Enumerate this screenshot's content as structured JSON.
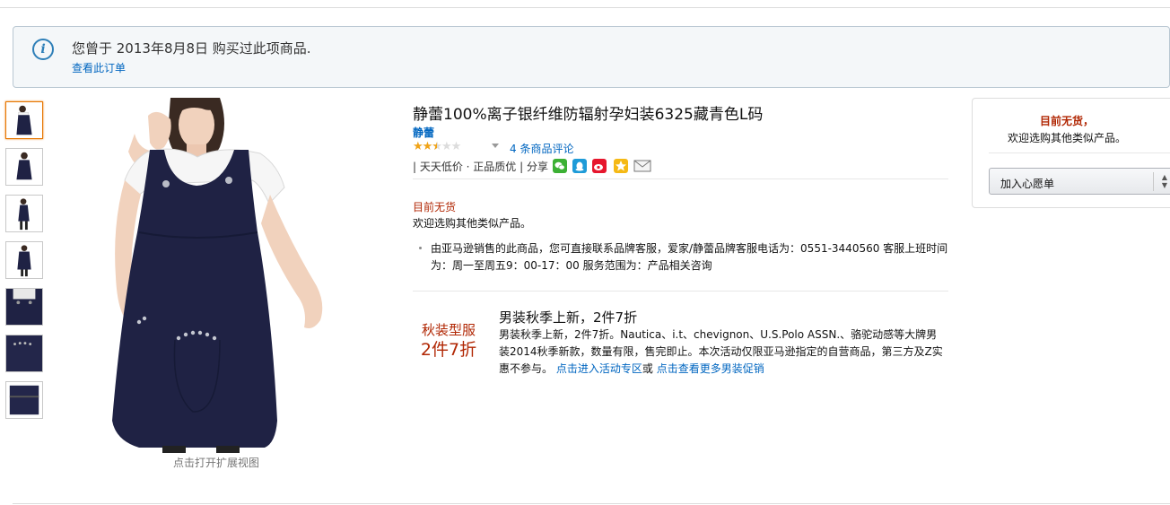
{
  "notice": {
    "message": "您曾于 2013年8月8日 购买过此项商品.",
    "view_order_link": "查看此订单",
    "icon": "info-icon"
  },
  "gallery": {
    "thumbnail_count": 7,
    "selected_index": 0,
    "expand_label": "点击打开扩展视图"
  },
  "product": {
    "title": "静蕾100%离子银纤维防辐射孕妇装6325藏青色L码",
    "brand": "静蕾",
    "rating": {
      "value": 2.5,
      "max": 5,
      "reviews_label": "4 条商品评论"
    },
    "tags_label": "| 天天低价 · 正品质优 | 分享",
    "share_icons": [
      "wechat-icon",
      "qq-icon",
      "weibo-icon",
      "qzone-icon",
      "email-icon"
    ],
    "availability": "目前无货",
    "availability_sub": "欢迎选购其他类似产品。",
    "bullet": "由亚马逊销售的此商品，您可直接联系品牌客服，爱家/静蕾品牌客服电话为：0551-3440560 客服上班时间为：周一至周五9：00-17：00 服务范围为：产品相关咨询"
  },
  "promo": {
    "badge_line1": "秋装型服",
    "badge_line2": "2件7折",
    "title": "男装秋季上新，2件7折",
    "description": "男装秋季上新，2件7折。Nautica、i.t、chevignon、U.S.Polo ASSN.、骆驼动感等大牌男装2014秋季新款，数量有限，售完即止。本次活动仅限亚马逊指定的自营商品，第三方及Z实惠不参与。",
    "link1": "点击进入活动专区",
    "link_joiner": "或",
    "link2": "点击查看更多男装促销"
  },
  "buybox": {
    "availability": "目前无货，",
    "sub": "欢迎选购其他类似产品。",
    "wishlist_label": "加入心愿单"
  },
  "colors": {
    "link": "#0066c0",
    "price_red": "#b12704",
    "star": "#f0a317",
    "dress": "#1f2244"
  }
}
